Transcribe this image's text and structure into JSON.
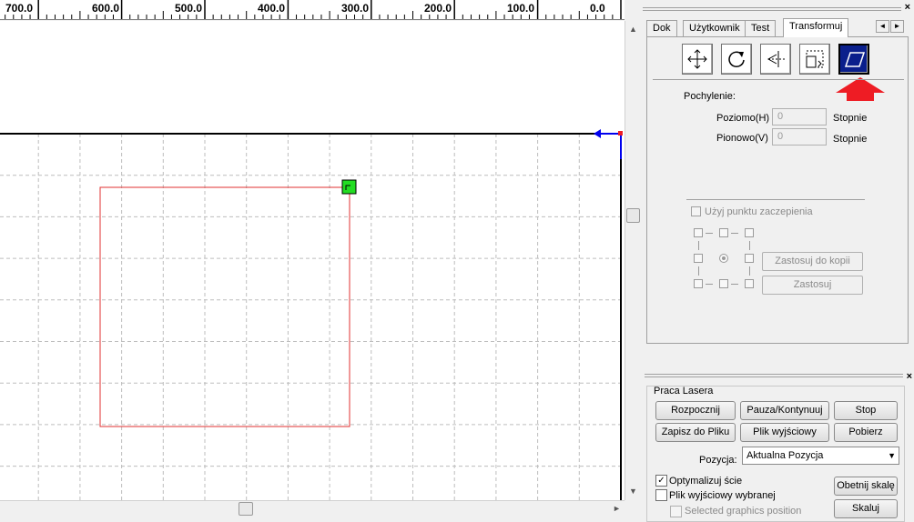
{
  "ruler": {
    "labels": [
      "700.0",
      "600.0",
      "500.0",
      "400.0",
      "300.0",
      "200.0",
      "100.0",
      "0.0"
    ]
  },
  "tabs": {
    "items": [
      "Dok",
      "Użytkownik",
      "Test",
      "Transformuj"
    ],
    "active": "Transformuj"
  },
  "transform": {
    "tools": [
      "move-icon",
      "rotate-icon",
      "mirror-icon",
      "scale-icon",
      "skew-icon"
    ],
    "active_tool": "skew-icon",
    "pochylenie_label": "Pochylenie:",
    "poziomo_label": "Poziomo(H)",
    "poziomo_value": "0",
    "pionowo_label": "Pionowo(V)",
    "pionowo_value": "0",
    "unit_label": "Stopnie",
    "use_anchor_label": "Użyj punktu zaczepienia",
    "apply_copy_label": "Zastosuj do kopii",
    "apply_label": "Zastosuj"
  },
  "laser": {
    "group_label": "Praca Lasera",
    "start_label": "Rozpocznij",
    "pause_label": "Pauza/Kontynuuj",
    "stop_label": "Stop",
    "save_file_label": "Zapisz do Pliku",
    "output_file_label": "Plik wyjściowy",
    "download_label": "Pobierz",
    "position_label": "Pozycja:",
    "position_value": "Aktualna Pozycja",
    "optimize_label": "Optymalizuj ście",
    "optimize_checked": true,
    "output_selected_label": "Plik wyjściowy wybranej",
    "output_selected_checked": false,
    "selected_graphics_label": "Selected graphics position",
    "crop_label": "Obetnij skalę",
    "scale_label": "Skaluj"
  },
  "colors": {
    "shape_outline": "#e03030",
    "handle": "#22dd22",
    "arrow_hint": "#ee1c24",
    "axis_x": "#0000ee",
    "grid": "#bdbdbd",
    "active_tool_bg": "#0a1f8c"
  }
}
